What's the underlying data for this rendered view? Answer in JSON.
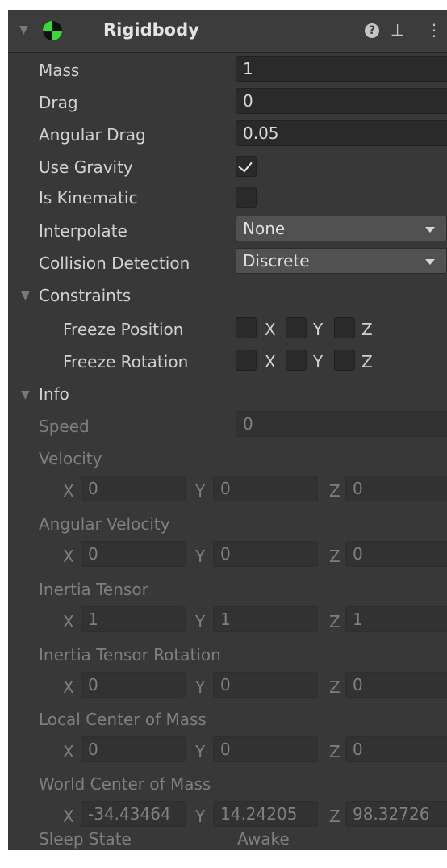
{
  "header": {
    "title": "Rigidbody",
    "help_label": "?",
    "presets_label": "⊥",
    "menu_label": "⋮"
  },
  "properties": {
    "mass": {
      "label": "Mass",
      "value": "1"
    },
    "drag": {
      "label": "Drag",
      "value": "0"
    },
    "angular_drag": {
      "label": "Angular Drag",
      "value": "0.05"
    },
    "use_gravity": {
      "label": "Use Gravity",
      "checked": true
    },
    "is_kinematic": {
      "label": "Is Kinematic",
      "checked": false
    },
    "interpolate": {
      "label": "Interpolate",
      "value": "None"
    },
    "collision_detection": {
      "label": "Collision Detection",
      "value": "Discrete"
    }
  },
  "constraints": {
    "label": "Constraints",
    "freeze_position": {
      "label": "Freeze Position",
      "x": "X",
      "y": "Y",
      "z": "Z"
    },
    "freeze_rotation": {
      "label": "Freeze Rotation",
      "x": "X",
      "y": "Y",
      "z": "Z"
    }
  },
  "info": {
    "label": "Info",
    "speed": {
      "label": "Speed",
      "value": "0"
    },
    "velocity": {
      "label": "Velocity",
      "x": "0",
      "y": "0",
      "z": "0"
    },
    "angular_velocity": {
      "label": "Angular Velocity",
      "x": "0",
      "y": "0",
      "z": "0"
    },
    "inertia_tensor": {
      "label": "Inertia Tensor",
      "x": "1",
      "y": "1",
      "z": "1"
    },
    "inertia_tensor_rotation": {
      "label": "Inertia Tensor Rotation",
      "x": "0",
      "y": "0",
      "z": "0"
    },
    "local_center_of_mass": {
      "label": "Local Center of Mass",
      "x": "0",
      "y": "0",
      "z": "0"
    },
    "world_center_of_mass": {
      "label": "World Center of Mass",
      "x": "-34.43464",
      "y": "14.24205",
      "z": "98.32726"
    },
    "sleep_state": {
      "label": "Sleep State",
      "value": "Awake"
    }
  },
  "axis_labels": {
    "x": "X",
    "y": "Y",
    "z": "Z"
  },
  "colors": {
    "panel": "#383838",
    "header": "#3c3c3c",
    "field": "#2a2a2a",
    "dropdown": "#515151",
    "icon_green": "#3dd63d"
  }
}
